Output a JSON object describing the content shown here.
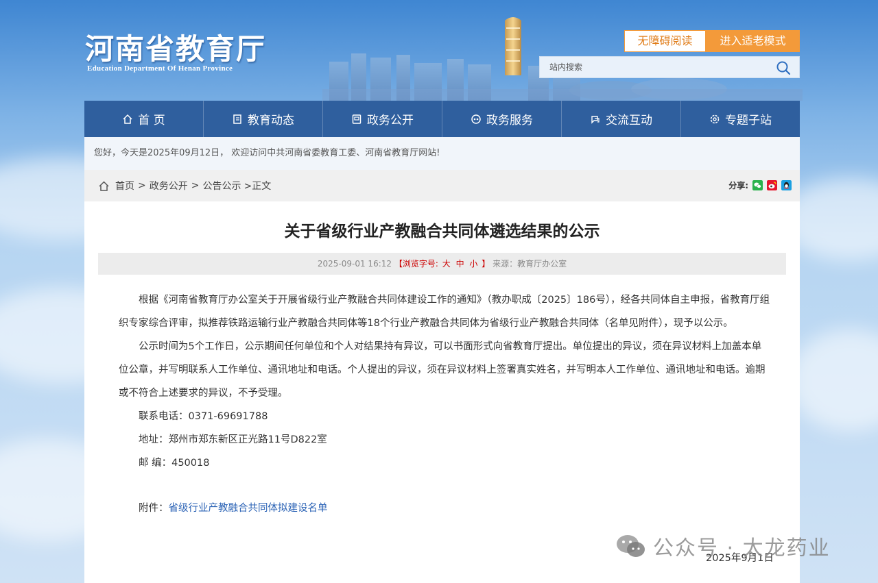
{
  "header": {
    "logo_cn": "河南省教育厅",
    "logo_en": "Education Department Of Henan Province",
    "accessibility_label": "无障碍阅读",
    "elder_mode_label": "进入适老模式",
    "search_placeholder": "站内搜索"
  },
  "nav": {
    "items": [
      {
        "label": "首 页",
        "icon": "home-icon"
      },
      {
        "label": "教育动态",
        "icon": "document-icon"
      },
      {
        "label": "政务公开",
        "icon": "folder-icon"
      },
      {
        "label": "政务服务",
        "icon": "service-icon"
      },
      {
        "label": "交流互动",
        "icon": "chat-icon"
      },
      {
        "label": "专题子站",
        "icon": "gear-icon"
      }
    ]
  },
  "welcome": "您好，今天是2025年09月12日， 欢迎访问中共河南省委教育工委、河南省教育厅网站!",
  "breadcrumb": {
    "home": "首页",
    "sep": ">",
    "level1": "政务公开",
    "level2": "公告公示",
    "current": ">正文"
  },
  "share_label": "分享:",
  "article": {
    "title": "关于省级行业产教融合共同体遴选结果的公示",
    "meta_date": "2025-09-01 16:12",
    "meta_font_prefix": "【浏览字号:",
    "font_large": "大",
    "font_medium": "中",
    "font_small": "小",
    "meta_font_suffix": "】",
    "meta_source": "来源：教育厅办公室",
    "para1": "根据《河南省教育厅办公室关于开展省级行业产教融合共同体建设工作的通知》（教办职成〔2025〕186号），经各共同体自主申报，省教育厅组织专家综合评审，拟推荐铁路运输行业产教融合共同体等18个行业产教融合共同体为省级行业产教融合共同体（名单见附件），现予以公示。",
    "para2": "公示时间为5个工作日，公示期间任何单位和个人对结果持有异议，可以书面形式向省教育厅提出。单位提出的异议，须在异议材料上加盖本单位公章，并写明联系人工作单位、通讯地址和电话。个人提出的异议，须在异议材料上签署真实姓名，并写明本人工作单位、通讯地址和电话。逾期或不符合上述要求的异议，不予受理。",
    "phone": "联系电话：0371-69691788",
    "address": "地址：郑州市郑东新区正光路11号D822室",
    "postcode": "邮 编：450018",
    "attach_label": "附件：",
    "attach_link": "省级行业产教融合共同体拟建设名单",
    "date": "2025年9月1日"
  },
  "watermark": "公众号 · 太龙药业",
  "colors": {
    "nav_bg": "#2f5f9e",
    "accent_orange": "#f39a3a",
    "meta_red": "#cc0000",
    "link_blue": "#2a62b5"
  }
}
